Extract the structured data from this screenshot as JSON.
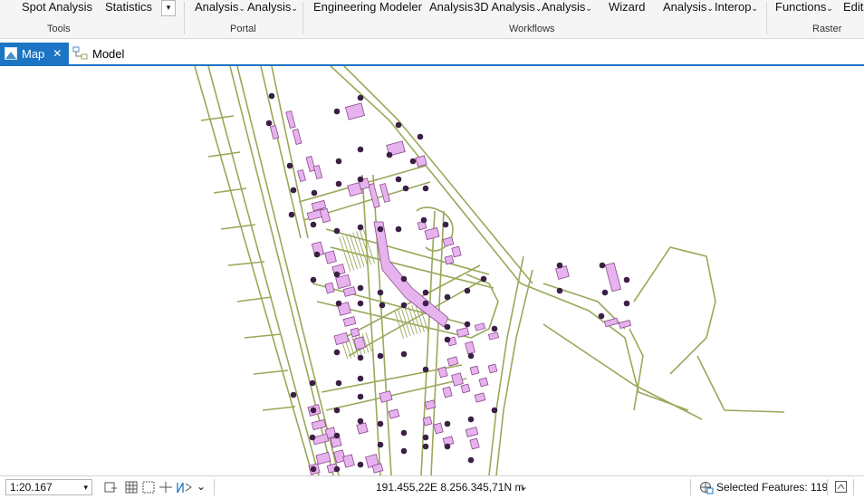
{
  "ribbon": {
    "groups": [
      {
        "label": "Tools",
        "items": [
          {
            "label": "Spot Analysis",
            "chevron": ""
          },
          {
            "label": "Statistics",
            "chevron": ""
          }
        ]
      },
      {
        "label": "Portal",
        "items": [
          {
            "label": "Analysis",
            "chevron": "⌄"
          },
          {
            "label": "Analysis",
            "chevron": "⌄"
          }
        ]
      },
      {
        "label": "Workflows",
        "items": [
          {
            "label": "Engineering",
            "chevron": ""
          },
          {
            "label": "Modeler",
            "chevron": ""
          },
          {
            "label": "Analysis",
            "chevron": ""
          },
          {
            "label": "3D Analysis",
            "chevron": "⌄"
          },
          {
            "label": "Analysis",
            "chevron": "⌄"
          },
          {
            "label": "Wizard",
            "chevron": ""
          },
          {
            "label": "Analysis",
            "chevron": "⌄"
          },
          {
            "label": "Interop",
            "chevron": "⌄"
          }
        ]
      },
      {
        "label": "Raster",
        "items": [
          {
            "label": "Functions",
            "chevron": "⌄"
          },
          {
            "label": "Edito",
            "chevron": ""
          }
        ]
      }
    ],
    "more_glyph": "▾"
  },
  "tabs": [
    {
      "label": "Map",
      "close": "✕",
      "icon": "map-icon"
    },
    {
      "label": "Model",
      "icon": "model-icon"
    }
  ],
  "map": {
    "road_color": "#9aa85a",
    "building_fill": "#e7b3ef",
    "building_stroke": "#8a4a8a",
    "point_color": "#3b1f45"
  },
  "status": {
    "scale": "1:20.167",
    "scale_arrow": "▾",
    "coordinates": "191.455,22E 8.256.345,71N m",
    "coord_arrow": "⌄",
    "nav_arrow": "⌄",
    "selected_features": "Selected Features: 119"
  }
}
